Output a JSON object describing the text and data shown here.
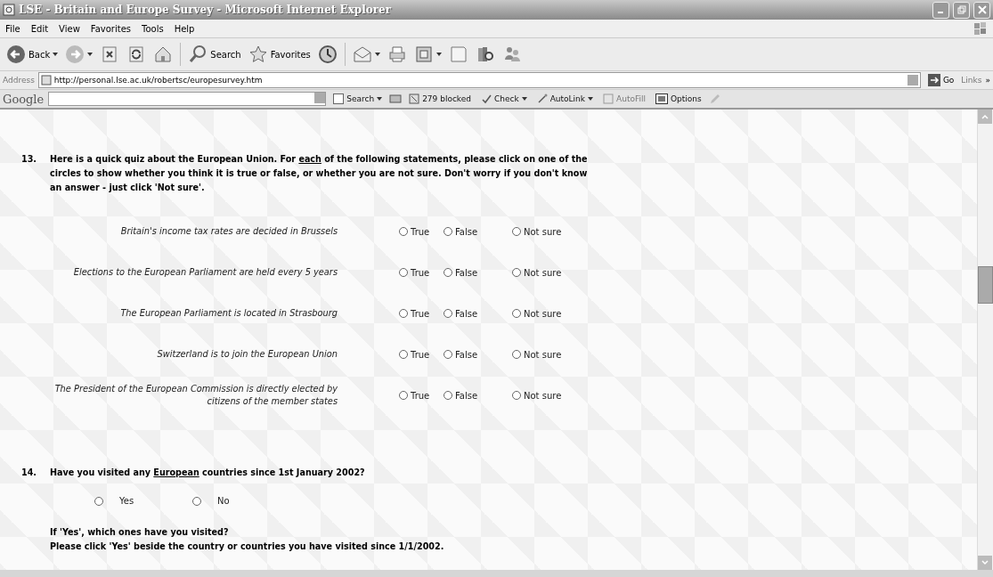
{
  "window": {
    "title": "LSE - Britain and Europe Survey - Microsoft Internet Explorer"
  },
  "menu": [
    "File",
    "Edit",
    "View",
    "Favorites",
    "Tools",
    "Help"
  ],
  "toolbar": [
    {
      "kind": "back",
      "label": "Back"
    },
    {
      "kind": "forward"
    },
    {
      "kind": "stop"
    },
    {
      "kind": "refresh"
    },
    {
      "kind": "home"
    },
    {
      "kind": "search",
      "label": "Search"
    },
    {
      "kind": "favorites",
      "label": "Favorites"
    },
    {
      "kind": "history"
    },
    {
      "kind": "mail"
    },
    {
      "kind": "print"
    },
    {
      "kind": "edit"
    },
    {
      "kind": "discuss"
    },
    {
      "kind": "research"
    },
    {
      "kind": "messenger"
    }
  ],
  "address": {
    "label": "Address",
    "value": "http://personal.lse.ac.uk/robertsc/europesurvey.htm",
    "go": "Go",
    "links": "Links",
    "more": "»"
  },
  "google_bar": {
    "logo": "Google",
    "search": "Search",
    "blocked": "279 blocked",
    "check": "Check",
    "autolink": "AutoLink",
    "autofill": "AutoFill",
    "autofill_disabled": true,
    "options": "Options"
  },
  "q13": {
    "number": "13.",
    "before": "Here is a quick quiz about the European Union.  For ",
    "underlined": "each",
    "after": " of the following statements, please click on one of the circles to show whether you think it is true or false, or whether you are not sure.  Don't worry if you don't know an answer - just click 'Not sure'.",
    "statements": [
      {
        "text": "Britain's income tax rates are decided in Brussels",
        "options": [
          {
            "label": "True",
            "selected": false
          },
          {
            "label": "False",
            "selected": false
          },
          {
            "label": "Not sure",
            "selected": false
          }
        ]
      },
      {
        "text": "Elections to the European Parliament are held every 5 years",
        "options": [
          {
            "label": "True",
            "selected": false
          },
          {
            "label": "False",
            "selected": false
          },
          {
            "label": "Not sure",
            "selected": false
          }
        ]
      },
      {
        "text": "The European Parliament is located in Strasbourg",
        "options": [
          {
            "label": "True",
            "selected": false
          },
          {
            "label": "False",
            "selected": false
          },
          {
            "label": "Not sure",
            "selected": false
          }
        ]
      },
      {
        "text": "Switzerland is to join the European Union",
        "options": [
          {
            "label": "True",
            "selected": false
          },
          {
            "label": "False",
            "selected": false
          },
          {
            "label": "Not sure",
            "selected": false
          }
        ]
      },
      {
        "text": "The President of the European Commission is directly elected by citizens of the member states",
        "options": [
          {
            "label": "True",
            "selected": false
          },
          {
            "label": "False",
            "selected": false
          },
          {
            "label": "Not sure",
            "selected": false
          }
        ]
      }
    ]
  },
  "q14": {
    "number": "14.",
    "before": "Have you visited any ",
    "underlined": "European",
    "after": " countries since 1st January 2002?",
    "options": [
      {
        "label": "Yes",
        "selected": false
      },
      {
        "label": "No",
        "selected": false
      }
    ],
    "followup": "If 'Yes', which ones have you visited?",
    "instruction": "Please click 'Yes' beside the country or countries you have visited since 1/1/2002."
  }
}
